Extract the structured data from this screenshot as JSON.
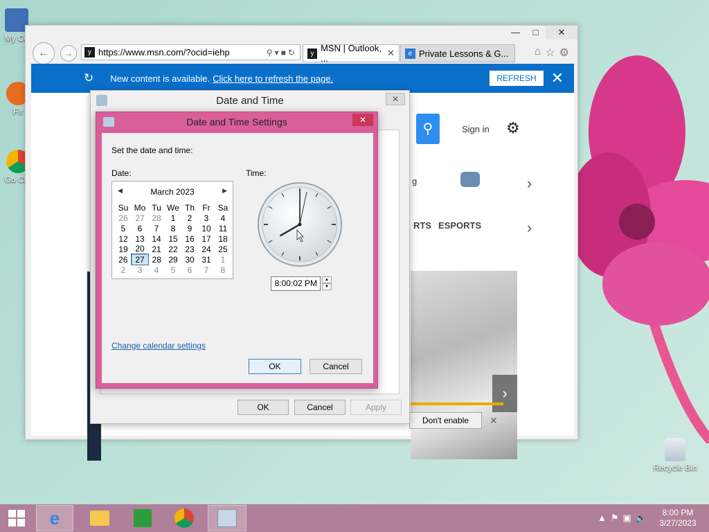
{
  "desktop": {
    "icons": [
      {
        "label": "My Co"
      },
      {
        "label": "Fir"
      },
      {
        "label": "Go Chr"
      },
      {
        "label": "Recycle Bin"
      }
    ]
  },
  "browser": {
    "address": "https://www.msn.com/?ocid=iehp",
    "tabs": [
      {
        "label": "MSN | Outlook, ..."
      },
      {
        "label": "Private Lessons & G..."
      }
    ],
    "notification": {
      "text": "New content is available.",
      "link": "Click here to refresh the page.",
      "button": "REFRESH"
    },
    "page": {
      "sign_in": "Sign in",
      "nav_esports": "ESPORTS",
      "nav_rts": "RTS",
      "nav_g": "g",
      "dont_enable": "Don't enable"
    }
  },
  "date_time_dialog": {
    "title": "Date and Time",
    "buttons": {
      "ok": "OK",
      "cancel": "Cancel",
      "apply": "Apply"
    }
  },
  "settings_dialog": {
    "title": "Date and Time Settings",
    "instruction": "Set the date and time:",
    "date_label": "Date:",
    "time_label": "Time:",
    "calendar": {
      "month_year": "March 2023",
      "weekdays": [
        "Su",
        "Mo",
        "Tu",
        "We",
        "Th",
        "Fr",
        "Sa"
      ],
      "weeks": [
        [
          "26",
          "27",
          "28",
          "1",
          "2",
          "3",
          "4"
        ],
        [
          "5",
          "6",
          "7",
          "8",
          "9",
          "10",
          "11"
        ],
        [
          "12",
          "13",
          "14",
          "15",
          "16",
          "17",
          "18"
        ],
        [
          "19",
          "20",
          "21",
          "22",
          "23",
          "24",
          "25"
        ],
        [
          "26",
          "27",
          "28",
          "29",
          "30",
          "31",
          "1"
        ],
        [
          "2",
          "3",
          "4",
          "5",
          "6",
          "7",
          "8"
        ]
      ],
      "selected": "27"
    },
    "time_value": "8:00:02 PM",
    "clock": {
      "hour": 8,
      "minute": 0,
      "second": 2
    },
    "change_calendar_link": "Change calendar settings",
    "buttons": {
      "ok": "OK",
      "cancel": "Cancel"
    }
  },
  "taskbar": {
    "time": "8:00 PM",
    "date": "3/27/2023"
  }
}
